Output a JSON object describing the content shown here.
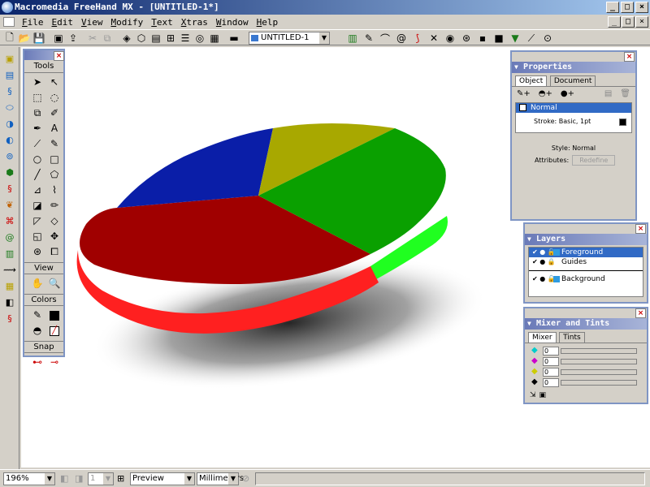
{
  "window": {
    "title": "Macromedia FreeHand MX - [UNTITLED-1*]",
    "btn_min": "_",
    "btn_max": "□",
    "btn_close": "×"
  },
  "menu": {
    "items": [
      "File",
      "Edit",
      "View",
      "Modify",
      "Text",
      "Xtras",
      "Window",
      "Help"
    ]
  },
  "toolbar": {
    "document_select": "UNTITLED-1"
  },
  "tools_panel": {
    "title": "Tools",
    "view_label": "View",
    "colors_label": "Colors",
    "snap_label": "Snap"
  },
  "properties": {
    "title": "Properties",
    "tabs": [
      "Object",
      "Document"
    ],
    "fill_label": "Normal",
    "stroke_label": "Stroke: Basic, 1pt",
    "style_label": "Style: Normal",
    "attributes_label": "Attributes:",
    "redefine_button": "Redefine"
  },
  "layers": {
    "title": "Layers",
    "items": [
      "Foreground",
      "Guides",
      "Background"
    ]
  },
  "mixer": {
    "title": "Mixer and Tints",
    "tabs": [
      "Mixer",
      "Tints"
    ],
    "values": [
      "0",
      "0",
      "0",
      "0"
    ]
  },
  "statusbar": {
    "zoom": "196%",
    "page": "1",
    "view_mode": "Preview",
    "units": "Millimeters"
  },
  "colors": {
    "pie_red": "#a00000",
    "pie_red_side": "#ff2020",
    "pie_blue": "#0a1ea8",
    "pie_olive": "#a8a800",
    "pie_green": "#0aa000",
    "pie_green_side": "#20ff20"
  }
}
